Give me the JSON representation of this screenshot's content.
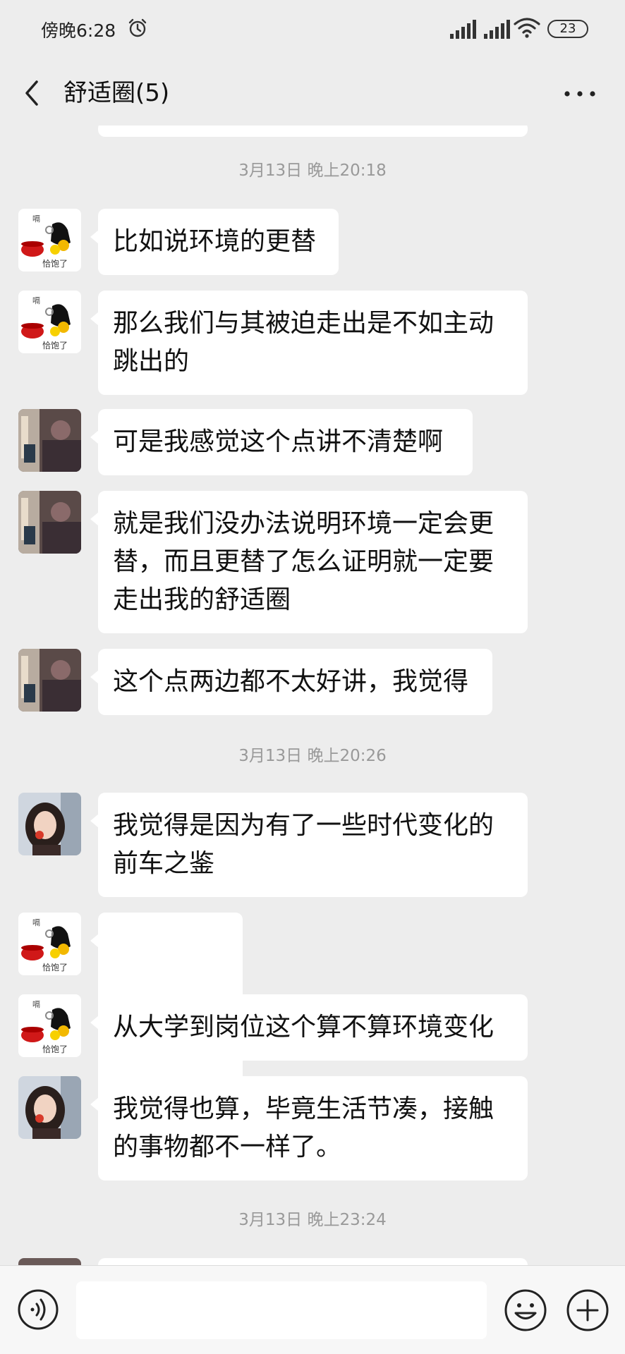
{
  "status": {
    "time": "傍晚6:28",
    "battery": "23"
  },
  "header": {
    "title": "舒适圈(5)"
  },
  "chat": {
    "timestamps": [
      "3月13日 晚上20:18",
      "3月13日 晚上20:26",
      "3月13日 晚上23:24"
    ],
    "messages": [
      {
        "sender": "恰饱了",
        "text": "比如说环境的更替"
      },
      {
        "sender": "恰饱了",
        "text": "那么我们与其被迫走出是不如主动跳出的"
      },
      {
        "sender": "concert-photo",
        "text": "可是我感觉这个点讲不清楚啊"
      },
      {
        "sender": "concert-photo",
        "text": "就是我们没办法说明环境一定会更替，而且更替了怎么证明就一定要走出我的舒适圈"
      },
      {
        "sender": "concert-photo",
        "text": "这个点两边都不太好讲，我觉得"
      },
      {
        "sender": "girl-photo",
        "text": "我觉得是因为有了一些时代变化的前车之鉴"
      },
      {
        "sender": "恰饱了",
        "emojis": [
          "🤔",
          "🤔",
          "🤔"
        ]
      },
      {
        "sender": "恰饱了",
        "text": "从大学到岗位这个算不算环境变化"
      },
      {
        "sender": "girl-photo",
        "text": "我觉得也算，毕竟生活节凑，接触的事物都不一样了。"
      }
    ],
    "avatar_labels": {
      "top": "嗝",
      "bottom": "恰饱了"
    }
  },
  "input": {
    "placeholder": ""
  },
  "colors": {
    "background": "#ededed",
    "bubble": "#ffffff",
    "timestamp": "#999999"
  }
}
